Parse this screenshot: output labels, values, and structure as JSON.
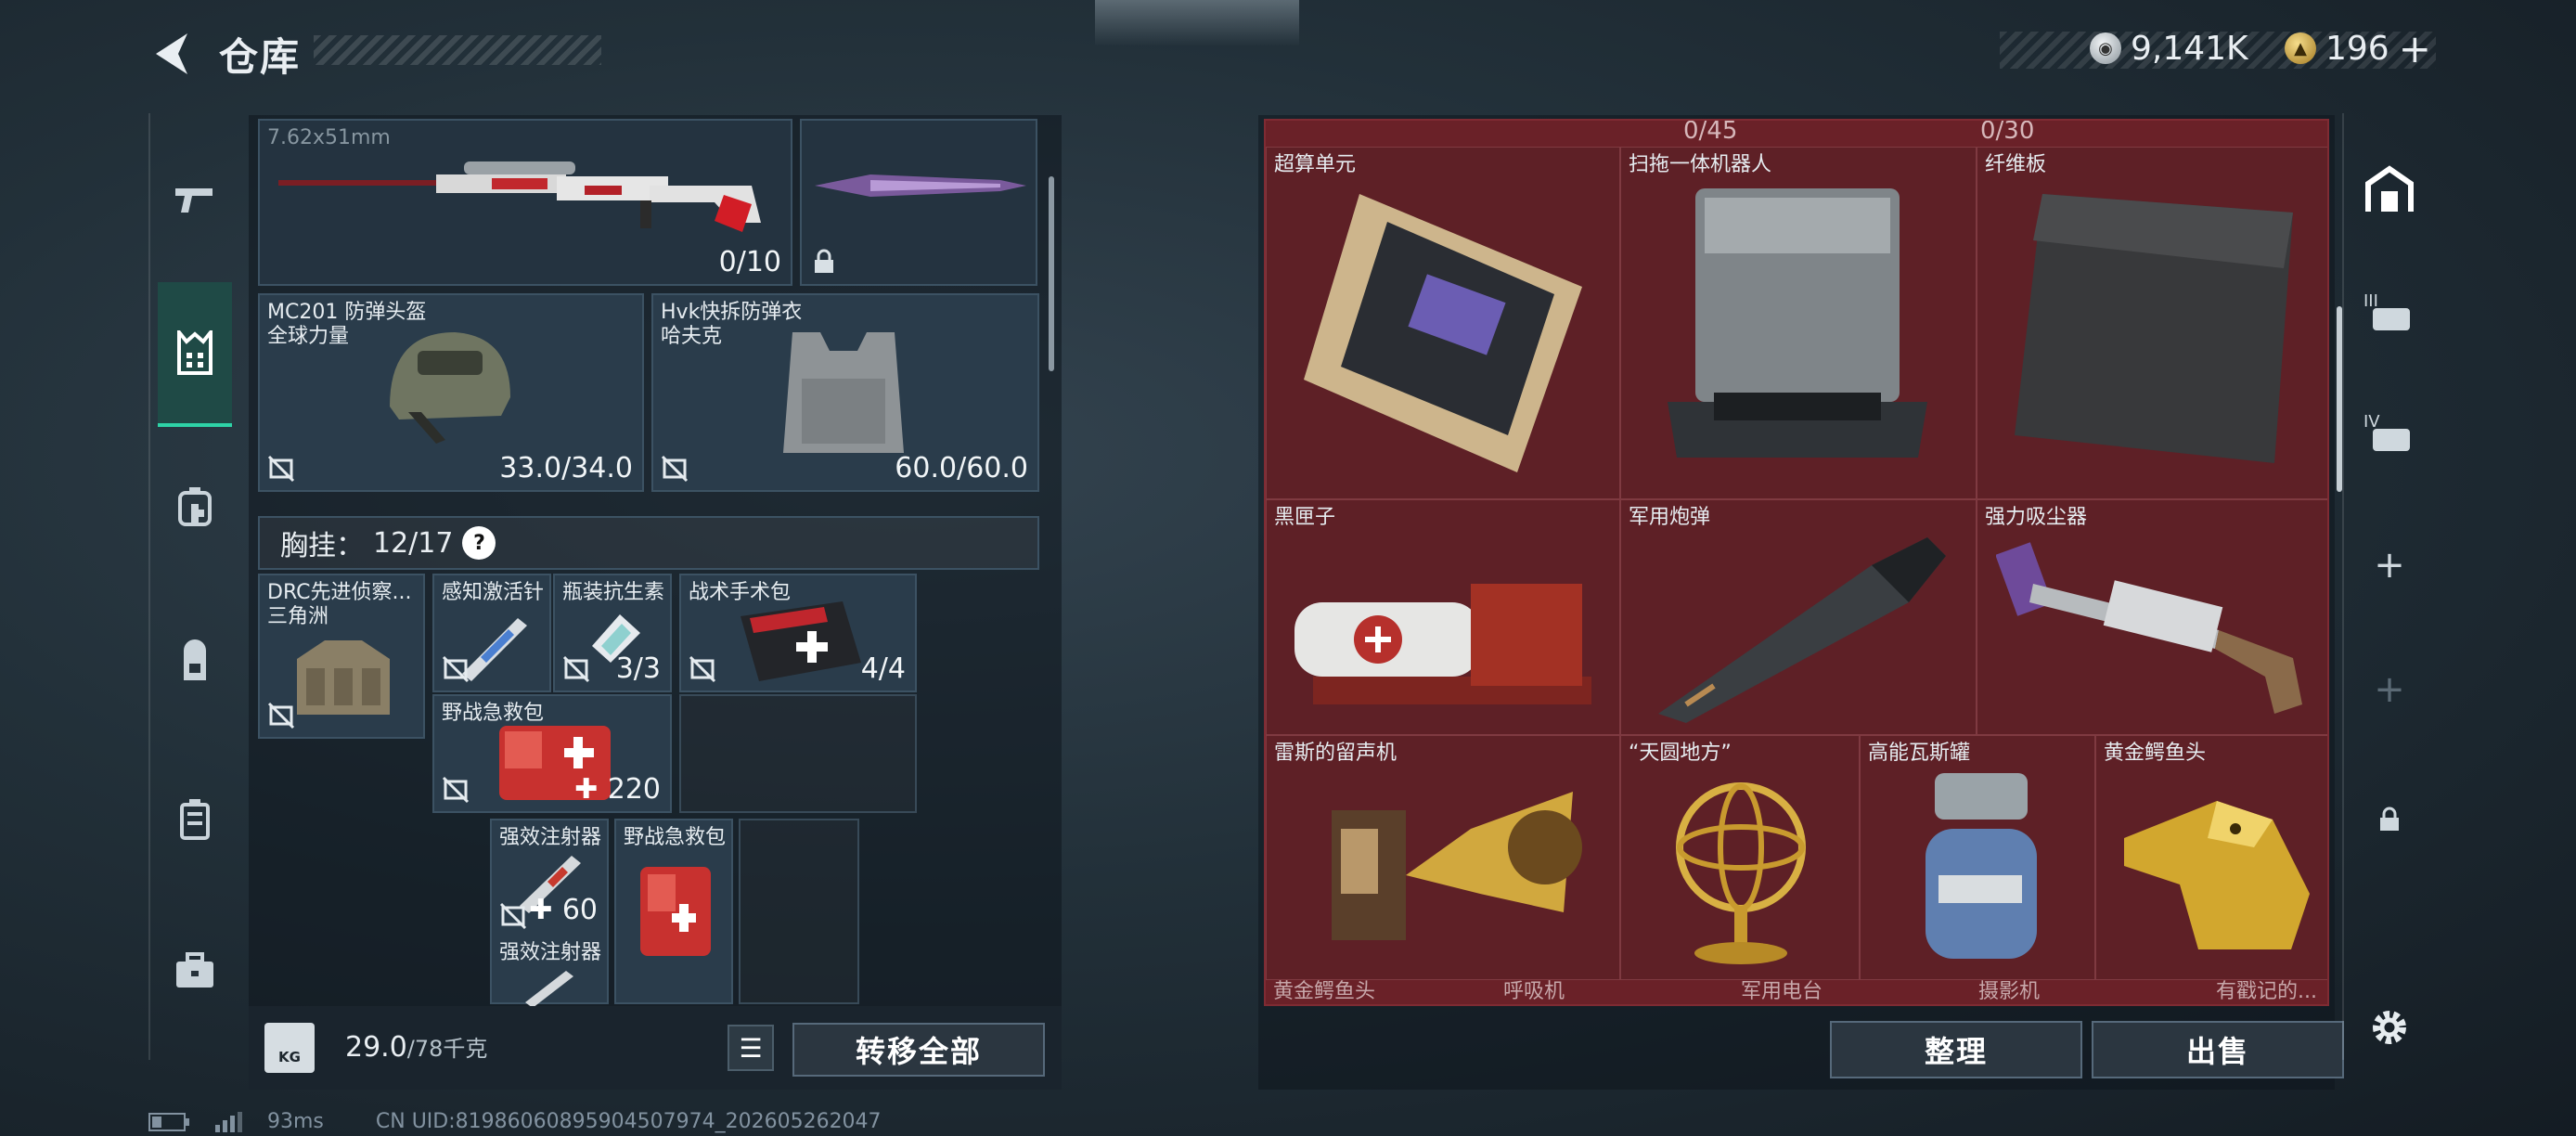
{
  "header": {
    "title": "仓库"
  },
  "currency": {
    "silver_value": "9,141K",
    "gold_value": "196",
    "add_label": "+",
    "silver_icon": "silver-coin-icon",
    "gold_icon": "gold-coin-icon"
  },
  "left_nav": {
    "items": [
      "gun-icon",
      "chest-rig-icon",
      "medical-backpack-icon",
      "backpack-icon",
      "case-icon",
      "toolbox-icon"
    ],
    "active": "chest-rig-icon"
  },
  "weapon": {
    "caliber": "7.62x51mm",
    "ammo": "0/10"
  },
  "helmet": {
    "name": "MC201 防弹头盔",
    "sub": "全球力量",
    "durability": "33.0/34.0"
  },
  "armor": {
    "name": "Hvk快拆防弹衣",
    "sub": "哈夫克",
    "durability": "60.0/60.0"
  },
  "chest": {
    "label": "胸挂：",
    "capacity": "12/17",
    "help": "?"
  },
  "chest_rig": {
    "name": "DRC先进侦察...",
    "sub": "三角洲"
  },
  "items": [
    {
      "name": "感知激活针"
    },
    {
      "name": "瓶装抗生素",
      "value": "3/3"
    },
    {
      "name": "战术手术包",
      "value": "4/4"
    },
    {
      "name": "野战急救包",
      "value": "220"
    },
    {
      "name": "强效注射器",
      "value": "60"
    },
    {
      "name": "强效注射器"
    },
    {
      "name": "野战急救包"
    }
  ],
  "bottom": {
    "weight": "29.0",
    "weight_max": "/78千克",
    "weight_icon_label": "KG",
    "transfer_all": "转移全部"
  },
  "storage": {
    "top_counts": [
      "0/45",
      "0/30"
    ],
    "cells": [
      "超算单元",
      "扫拖一体机器人",
      "纤维板",
      "黑匣子",
      "军用炮弹",
      "强力吸尘器",
      "雷斯的留声机",
      "“天圆地方”",
      "高能瓦斯罐",
      "黄金鳄鱼头"
    ],
    "bottom_row": [
      "黄金鳄鱼头",
      "呼吸机",
      "军用电台",
      "摄影机",
      "有戳记的..."
    ]
  },
  "actions": {
    "sort": "整理",
    "sell": "出售"
  },
  "right_nav": {
    "items": [
      "home-icon",
      "tier3-icon",
      "tier4-icon",
      "plus-icon",
      "plus-icon",
      "lock-icon"
    ],
    "settings": "gear-icon"
  },
  "footer": {
    "ping": "93ms",
    "uid": "CN UID:81986060895904507974_202605262047"
  },
  "colors": {
    "accent": "#2ed3a7",
    "storage_bg": "#6a2128",
    "slot_bg": "#2a3c4b"
  }
}
